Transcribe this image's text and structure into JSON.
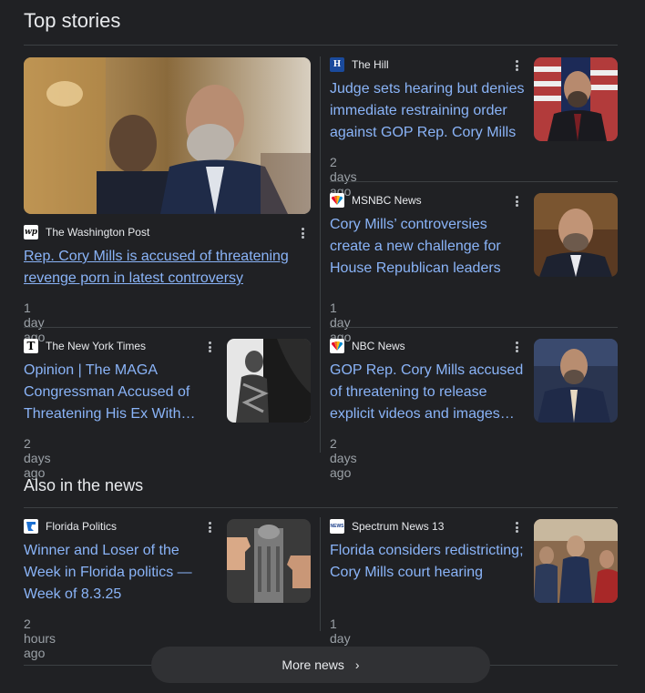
{
  "top_stories": {
    "title": "Top stories",
    "articles": [
      {
        "source": "The Washington Post",
        "source_icon": "washington-post-logo-icon",
        "icon_text": "wp",
        "headline": "Rep. Cory Mills is accused of threatening revenge porn in latest controversy",
        "time": "1 day ago"
      },
      {
        "source": "The Hill",
        "source_icon": "the-hill-logo-icon",
        "icon_text": "H",
        "headline": "Judge sets hearing but denies immediate restraining order against GOP Rep. Cory Mills",
        "time": "2 days ago"
      },
      {
        "source": "MSNBC News",
        "source_icon": "msnbc-peacock-icon",
        "icon_text": "",
        "headline": "Cory Mills’ controversies create a new challenge for House Republican leaders",
        "time": "1 day ago"
      },
      {
        "source": "The New York Times",
        "source_icon": "nyt-logo-icon",
        "icon_text": "T",
        "headline": "Opinion | The MAGA Congressman Accused of Threatening His Ex With…",
        "time": "2 days ago"
      },
      {
        "source": "NBC News",
        "source_icon": "nbc-peacock-icon",
        "icon_text": "",
        "headline": "GOP Rep. Cory Mills accused of threatening to release explicit videos and images o…",
        "time": "2 days ago"
      }
    ]
  },
  "also_in_news": {
    "title": "Also in the news",
    "articles": [
      {
        "source": "Florida Politics",
        "source_icon": "florida-politics-icon",
        "icon_text": "",
        "headline": "Winner and Loser of the Week in Florida politics — Week of 8.3.25",
        "time": "2 hours ago"
      },
      {
        "source": "Spectrum News 13",
        "source_icon": "spectrum-news-icon",
        "icon_text": "NEWS",
        "headline": "Florida considers redistricting; Cory Mills court hearing",
        "time": "1 day ago"
      }
    ]
  },
  "more_news": {
    "label": "More news"
  },
  "colors": {
    "background": "#202124",
    "link": "#8ab4f8",
    "meta": "#9aa0a6",
    "divider": "#3c4043"
  }
}
